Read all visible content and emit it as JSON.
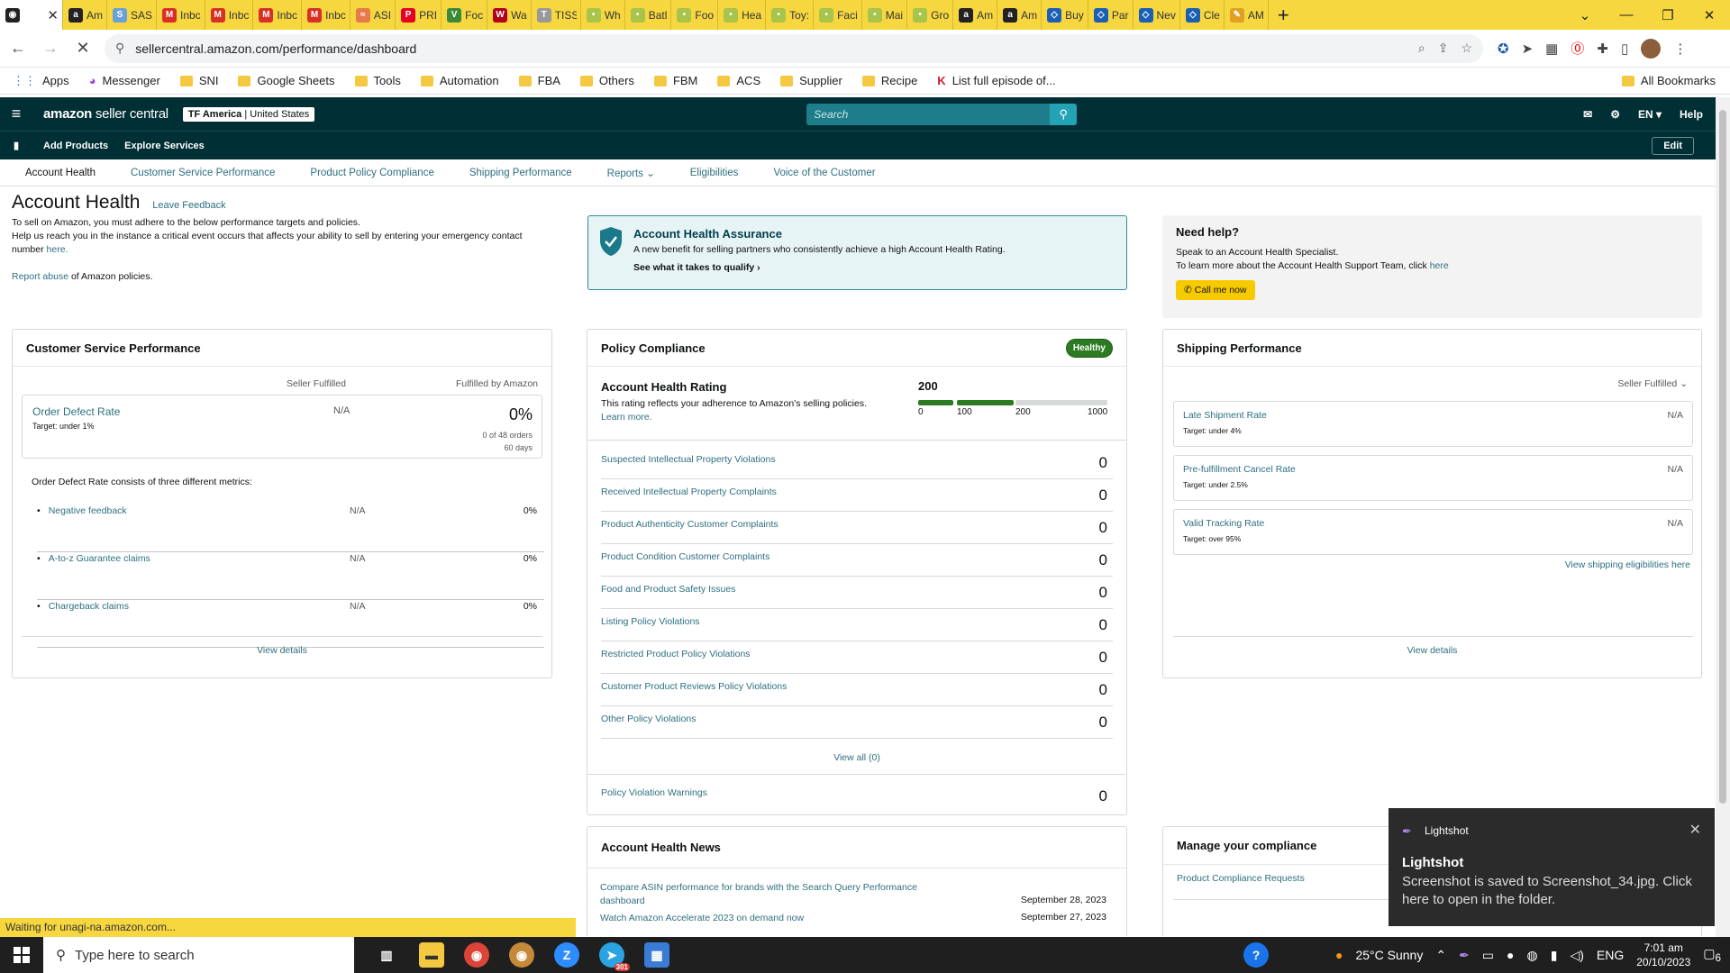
{
  "browser": {
    "tabs": [
      {
        "label": "Am",
        "fav": "a",
        "color": "#222"
      },
      {
        "label": "SAS",
        "fav": "S",
        "color": "#6aa0d8"
      },
      {
        "label": "Inbc",
        "fav": "M",
        "color": "#d93025"
      },
      {
        "label": "Inbc",
        "fav": "M",
        "color": "#d93025"
      },
      {
        "label": "Inbc",
        "fav": "M",
        "color": "#d93025"
      },
      {
        "label": "Inbc",
        "fav": "M",
        "color": "#d93025"
      },
      {
        "label": "ASI",
        "fav": "≈",
        "color": "#e8794a"
      },
      {
        "label": "PRI",
        "fav": "P",
        "color": "#e60023"
      },
      {
        "label": "Foc",
        "fav": "V",
        "color": "#3a8a3a"
      },
      {
        "label": "Wa",
        "fav": "W",
        "color": "#b3001b"
      },
      {
        "label": "TISS",
        "fav": "T",
        "color": "#999"
      },
      {
        "label": "Wh",
        "fav": "•",
        "color": "#a8c44a"
      },
      {
        "label": "Batl",
        "fav": "•",
        "color": "#a8c44a"
      },
      {
        "label": "Foo",
        "fav": "•",
        "color": "#a8c44a"
      },
      {
        "label": "Hea",
        "fav": "•",
        "color": "#a8c44a"
      },
      {
        "label": "Toy:",
        "fav": "•",
        "color": "#a8c44a"
      },
      {
        "label": "Faci",
        "fav": "•",
        "color": "#a8c44a"
      },
      {
        "label": "Mai",
        "fav": "•",
        "color": "#a8c44a"
      },
      {
        "label": "Gro",
        "fav": "•",
        "color": "#a8c44a"
      },
      {
        "label": "Am",
        "fav": "a",
        "color": "#222"
      },
      {
        "label": "Am",
        "fav": "a",
        "color": "#222"
      },
      {
        "label": "Buy",
        "fav": "◇",
        "color": "#1a5fb4"
      },
      {
        "label": "Par",
        "fav": "◇",
        "color": "#1a5fb4"
      },
      {
        "label": "Nev",
        "fav": "◇",
        "color": "#1a5fb4"
      },
      {
        "label": "Cle",
        "fav": "◇",
        "color": "#1a5fb4"
      },
      {
        "label": "AM",
        "fav": "✎",
        "color": "#e0a020"
      }
    ],
    "url": "sellercentral.amazon.com/performance/dashboard",
    "bookmarks": [
      "SNI",
      "Google Sheets",
      "Tools",
      "Automation",
      "FBA",
      "Others",
      "FBM",
      "ACS",
      "Supplier",
      "Recipe"
    ],
    "apps_label": "Apps",
    "messenger_label": "Messenger",
    "episode_label": "List full episode of...",
    "all_bookmarks": "All Bookmarks",
    "status": "Waiting for unagi-na.amazon.com..."
  },
  "sc": {
    "logo_bold": "amazon",
    "logo_rest": " seller central",
    "market_bold": "TF America",
    "market_rest": " | United States",
    "search_placeholder": "Search",
    "lang": "EN",
    "help": "Help",
    "add_products": "Add Products",
    "explore_services": "Explore Services",
    "edit": "Edit",
    "page_tabs": [
      "Account Health",
      "Customer Service Performance",
      "Product Policy Compliance",
      "Shipping Performance",
      "Reports",
      "Eligibilities",
      "Voice of the Customer"
    ]
  },
  "page": {
    "title": "Account Health",
    "leave_feedback": "Leave Feedback",
    "intro1": "To sell on Amazon, you must adhere to the below performance targets and policies.",
    "intro2": "Help us reach you in the instance a critical event occurs that affects your ability to sell by entering your emergency contact number",
    "here": "here.",
    "report_abuse": "Report abuse",
    "report_abuse_rest": " of Amazon policies.",
    "assurance_title": "Account Health Assurance",
    "assurance_desc": "A new benefit for selling partners who consistently achieve a high Account Health Rating.",
    "assurance_link": "See what it takes to qualify",
    "help_title": "Need help?",
    "help_line1": "Speak to an Account Health Specialist.",
    "help_line2": "To learn more about the Account Health Support Team, click",
    "help_here": "here",
    "call_me": "Call me now"
  },
  "csp": {
    "title": "Customer Service Performance",
    "col_sf": "Seller Fulfilled",
    "col_fba": "Fulfilled by Amazon",
    "odr_name": "Order Defect Rate",
    "odr_target": "Target: under 1%",
    "odr_sf": "N/A",
    "odr_fba": "0%",
    "odr_orders": "0 of 48 orders",
    "odr_days": "60 days",
    "consists": "Order Defect Rate consists of three different metrics:",
    "metrics": [
      {
        "name": "Negative feedback",
        "sf": "N/A",
        "fba": "0%"
      },
      {
        "name": "A-to-z Guarantee claims",
        "sf": "N/A",
        "fba": "0%"
      },
      {
        "name": "Chargeback claims",
        "sf": "N/A",
        "fba": "0%"
      }
    ],
    "view_details": "View details"
  },
  "policy": {
    "title": "Policy Compliance",
    "badge": "Healthy",
    "ahr_title": "Account Health Rating",
    "ahr_desc": "This rating reflects your adherence to Amazon's selling policies.",
    "learn_more": "Learn more.",
    "score": "200",
    "ticks": [
      "0",
      "100",
      "200",
      "1000"
    ],
    "rows": [
      {
        "label": "Suspected Intellectual Property Violations",
        "value": "0"
      },
      {
        "label": "Received Intellectual Property Complaints",
        "value": "0"
      },
      {
        "label": "Product Authenticity Customer Complaints",
        "value": "0"
      },
      {
        "label": "Product Condition Customer Complaints",
        "value": "0"
      },
      {
        "label": "Food and Product Safety Issues",
        "value": "0"
      },
      {
        "label": "Listing Policy Violations",
        "value": "0"
      },
      {
        "label": "Restricted Product Policy Violations",
        "value": "0"
      },
      {
        "label": "Customer Product Reviews Policy Violations",
        "value": "0"
      },
      {
        "label": "Other Policy Violations",
        "value": "0"
      }
    ],
    "view_all": "View all (0)",
    "warnings_label": "Policy Violation Warnings",
    "warnings_value": "0"
  },
  "news": {
    "title": "Account Health News",
    "items": [
      {
        "text": "Compare ASIN performance for brands with the Search Query Performance dashboard",
        "date": "September 28, 2023"
      },
      {
        "text": "Watch Amazon Accelerate 2023 on demand now",
        "date": "September 27, 2023"
      }
    ]
  },
  "shipping": {
    "title": "Shipping Performance",
    "filter": "Seller Fulfilled",
    "rows": [
      {
        "name": "Late Shipment Rate",
        "target": "Target: under 4%",
        "value": "N/A"
      },
      {
        "name": "Pre-fulfillment Cancel Rate",
        "target": "Target: under 2.5%",
        "value": "N/A"
      },
      {
        "name": "Valid Tracking Rate",
        "target": "Target: over 95%",
        "value": "N/A"
      }
    ],
    "eligibilities": "View shipping eligibilities here",
    "view_details": "View details"
  },
  "manage": {
    "title": "Manage your compliance",
    "requests": "Product Compliance Requests"
  },
  "toast": {
    "app": "Lightshot",
    "title": "Lightshot",
    "message": "Screenshot is saved to Screenshot_34.jpg. Click here to open in the folder."
  },
  "taskbar": {
    "search_placeholder": "Type here to search",
    "weather": "25°C  Sunny",
    "lang": "ENG",
    "time": "7:01 am",
    "date": "20/10/2023",
    "notif_count": "6",
    "telegram_badge": "301"
  }
}
